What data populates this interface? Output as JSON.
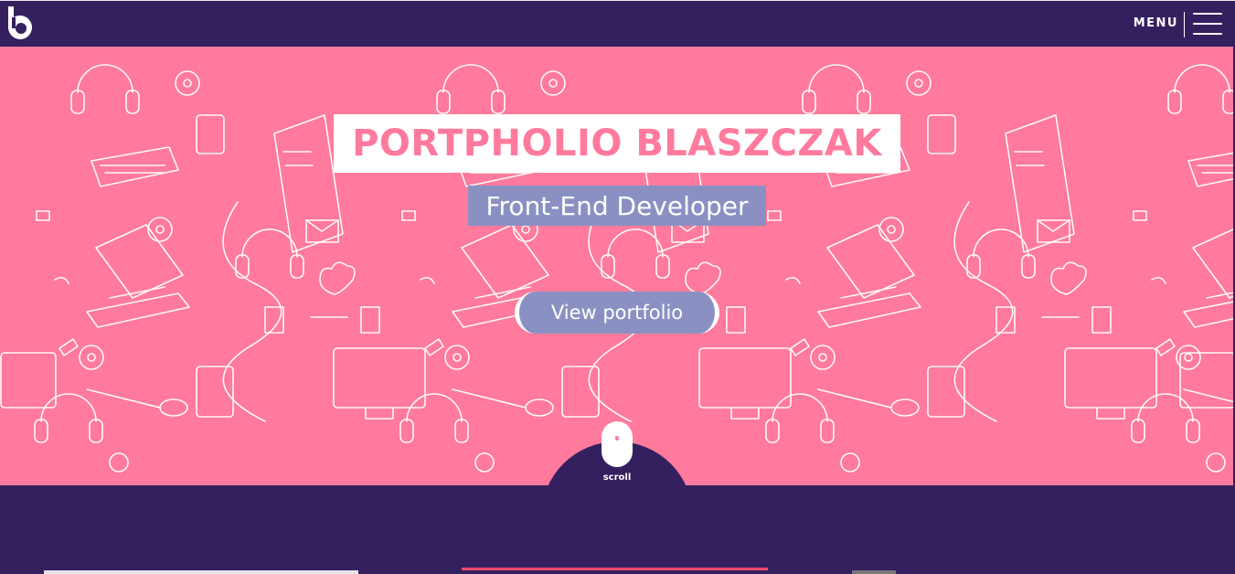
{
  "header": {
    "logo_letter": "b",
    "menu_label": "MENU"
  },
  "hero": {
    "title": "PORTPHOLIO BLASZCZAK",
    "subtitle": "Front-End Developer",
    "cta_label": "View portfolio",
    "scroll_label": "scroll"
  },
  "colors": {
    "navy": "#35205f",
    "pink": "#ff7a9c",
    "lavender": "#8a91c2",
    "white": "#ffffff"
  },
  "icons": [
    "logo-icon",
    "hamburger-icon",
    "mouse-icon",
    "doodle-pattern"
  ]
}
